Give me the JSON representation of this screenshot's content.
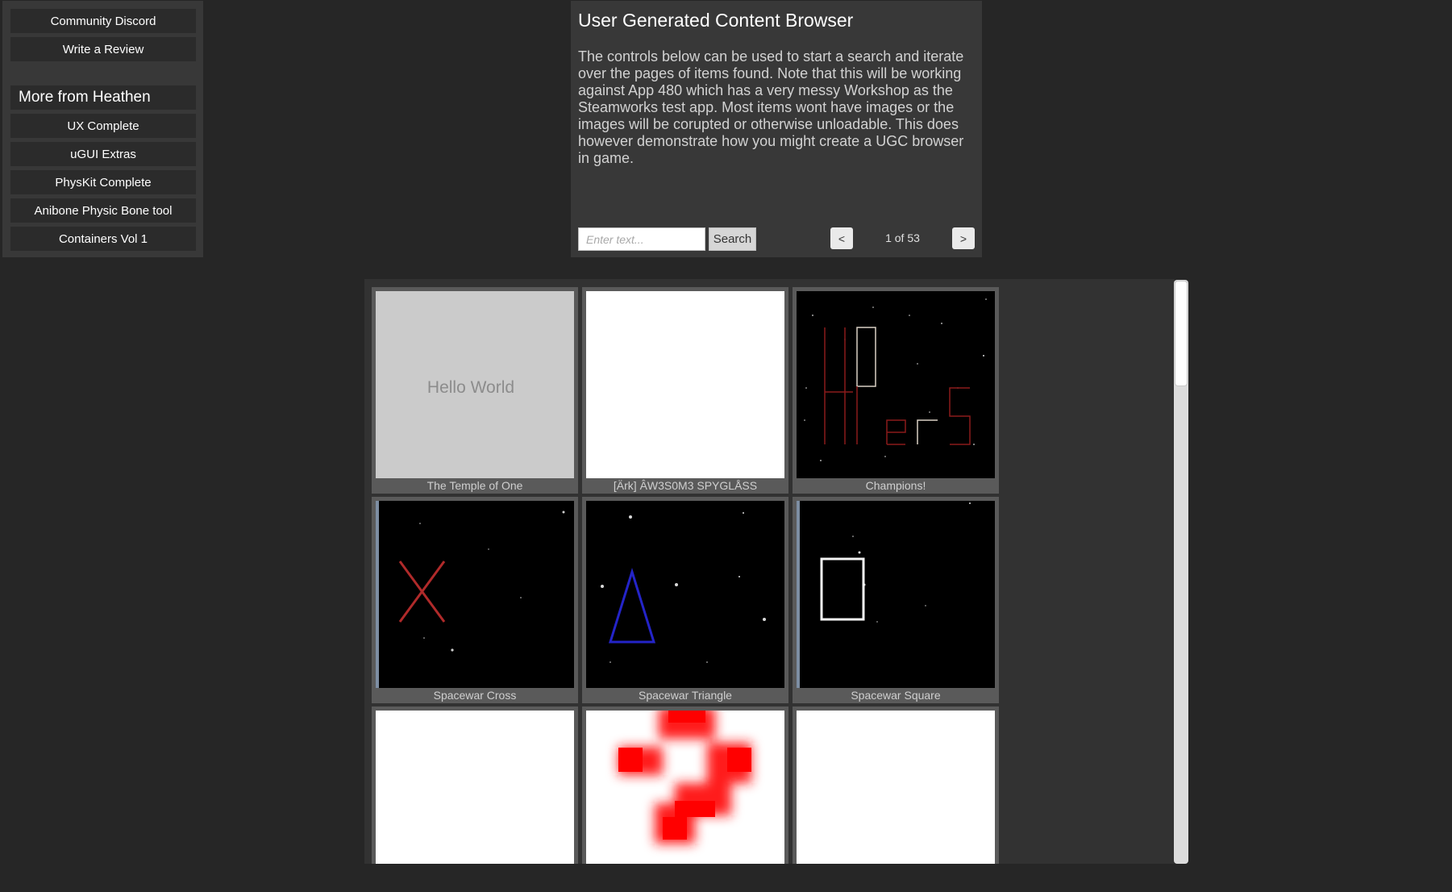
{
  "sidebar": {
    "links": [
      {
        "label": "Community Discord"
      },
      {
        "label": "Write a Review"
      }
    ],
    "more_heading": "More from Heathen",
    "products": [
      {
        "label": "UX Complete"
      },
      {
        "label": "uGUI Extras"
      },
      {
        "label": "PhysKit Complete"
      },
      {
        "label": "Anibone Physic Bone tool"
      },
      {
        "label": "Containers Vol 1"
      }
    ]
  },
  "browser": {
    "title": "User Generated Content Browser",
    "description": "The controls below can be used to start a search and iterate over the pages of items found. Note that this will be working against App 480 which has a very messy Workshop as the Steamworks test app. Most items wont have images or the images will be corupted or otherwise unloadable. This does however demonstrate how you might create a UGC browser in game.",
    "search_placeholder": "Enter text...",
    "search_value": "",
    "search_button": "Search",
    "prev_button": "<",
    "next_button": ">",
    "page_info": "1 of 53"
  },
  "items": [
    {
      "title": "The Temple of One",
      "thumb": "hello-world",
      "thumb_text": "Hello World"
    },
    {
      "title": "[Ärk] ÂW3S0M3 SPYGLÅSS",
      "thumb": "blank"
    },
    {
      "title": "Champions!",
      "thumb": "49ers"
    },
    {
      "title": "Spacewar Cross",
      "thumb": "cross"
    },
    {
      "title": "Spacewar Triangle",
      "thumb": "triangle"
    },
    {
      "title": "Spacewar Square",
      "thumb": "square"
    },
    {
      "title": "",
      "thumb": "blank"
    },
    {
      "title": "",
      "thumb": "question"
    },
    {
      "title": "",
      "thumb": "blank"
    }
  ],
  "colors": {
    "background": "#262626",
    "panel": "#383838",
    "button": "#2b2b2b",
    "card_frame": "#5a5a5a",
    "grid_panel": "#323232"
  }
}
